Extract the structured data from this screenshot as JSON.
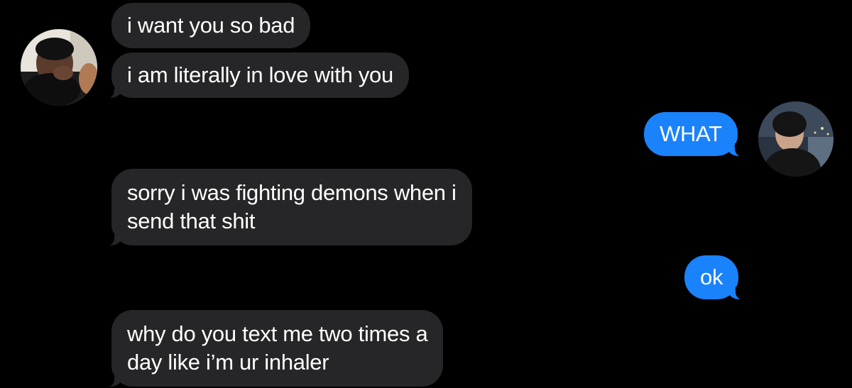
{
  "conversation": {
    "messages": [
      {
        "sender": "contact",
        "lines": [
          "i want you so bad"
        ]
      },
      {
        "sender": "contact",
        "lines": [
          "i am literally in love with you"
        ]
      },
      {
        "sender": "me",
        "lines": [
          "WHAT"
        ]
      },
      {
        "sender": "contact",
        "lines": [
          "sorry i was fighting demons when i",
          "send that shit"
        ]
      },
      {
        "sender": "me",
        "lines": [
          "ok"
        ]
      },
      {
        "sender": "contact",
        "lines": [
          "why do you text me two times a",
          "day like i’m ur inhaler"
        ]
      }
    ]
  },
  "colors": {
    "background": "#000000",
    "incoming_bubble": "#262628",
    "outgoing_bubble": "#1a82fb",
    "text": "#ffffff"
  }
}
